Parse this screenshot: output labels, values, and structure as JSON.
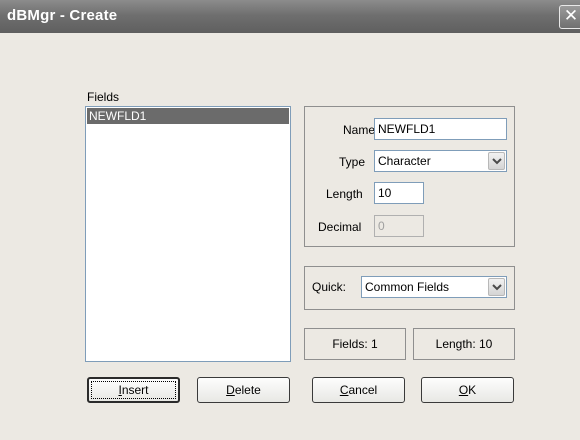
{
  "window": {
    "title": "dBMgr - Create",
    "close_glyph": "✕"
  },
  "fields_list": {
    "label": "Fields",
    "items": [
      "NEWFLD1"
    ],
    "selected_index": 0
  },
  "field_props": {
    "name_label": "Name",
    "name_value": "NEWFLD1",
    "type_label": "Type",
    "type_value": "Character",
    "length_label": "Length",
    "length_value": "10",
    "decimal_label": "Decimal",
    "decimal_value": "0"
  },
  "quick": {
    "label": "Quick:",
    "value": "Common Fields"
  },
  "status": {
    "fields_text": "Fields: 1",
    "length_text": "Length: 10"
  },
  "buttons": {
    "insert": {
      "accel": "I",
      "rest": "nsert"
    },
    "delete": {
      "accel": "D",
      "rest": "elete"
    },
    "cancel": {
      "accel": "C",
      "rest": "ancel"
    },
    "ok": {
      "accel": "O",
      "rest": "K"
    }
  },
  "icons": {
    "close": "close-icon",
    "dropdown": "chevron-down-icon"
  }
}
